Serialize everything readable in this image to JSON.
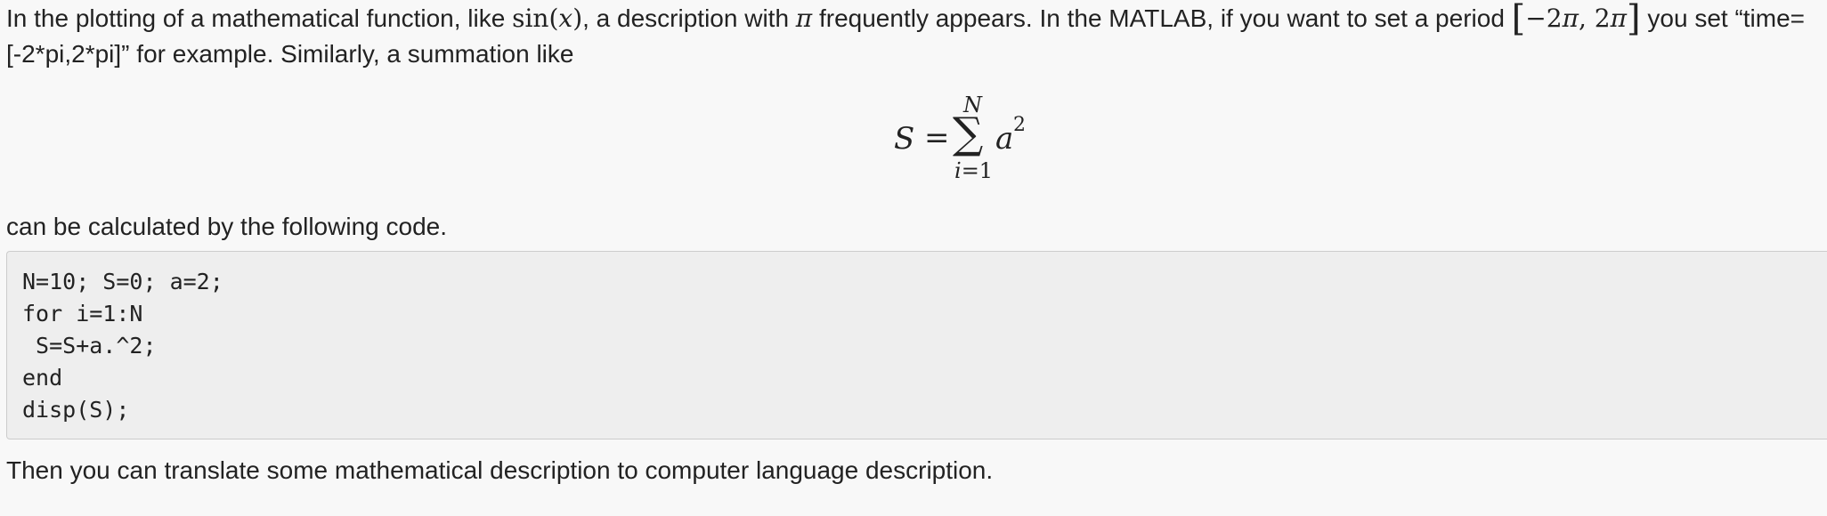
{
  "intro": {
    "t1": "In the plotting of a mathematical function, like ",
    "m1_fn": "sin",
    "m1_open": "(",
    "m1_var": "x",
    "m1_close": ")",
    "t2": ", a description with ",
    "m2_pi": "π",
    "t3": " frequently appears. In the MATLAB, if you want to set a period ",
    "m3_open": "[",
    "m3_neg": "−2",
    "m3_pi1": "π",
    "m3_comma": ", 2",
    "m3_pi2": "π",
    "m3_close": "]",
    "t4": " you set “time=",
    "line2": "[-2*pi,2*pi]” for example. Similarly, a summation like"
  },
  "equation": {
    "lhs": "S",
    "equals": "=",
    "sigma": "∑",
    "upper": "N",
    "lower_var": "i",
    "lower_rest": "=1",
    "term": "a",
    "exponent": "2"
  },
  "after_equation": "can be calculated by the following code.",
  "code": {
    "lines": [
      "N=10; S=0; a=2;",
      "for i=1:N",
      " S=S+a.^2;",
      "end",
      "disp(S);"
    ]
  },
  "closing": "Then you can translate some mathematical description to computer language description."
}
